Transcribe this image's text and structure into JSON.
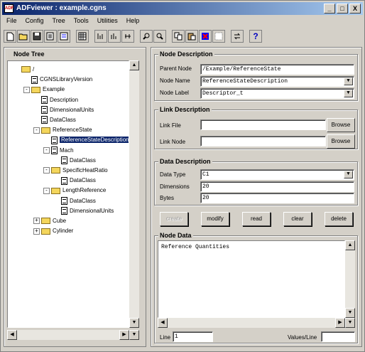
{
  "window": {
    "title": "ADFviewer : example.cgns",
    "app_icon_text": "ADF",
    "minimize": "_",
    "maximize": "□",
    "close": "X"
  },
  "menu": [
    "File",
    "Config",
    "Tree",
    "Tools",
    "Utilities",
    "Help"
  ],
  "toolbar": {
    "help_label": "?"
  },
  "node_tree": {
    "title": "Node Tree",
    "nodes": [
      {
        "label": "/",
        "type": "folder",
        "expander": ""
      },
      {
        "label": "CGNSLibraryVersion",
        "type": "doc",
        "expander": ""
      },
      {
        "label": "Example",
        "type": "folder",
        "expander": "-"
      },
      {
        "label": "Description",
        "type": "doc",
        "expander": ""
      },
      {
        "label": "DimensionalUnits",
        "type": "doc",
        "expander": ""
      },
      {
        "label": "DataClass",
        "type": "doc",
        "expander": ""
      },
      {
        "label": "ReferenceState",
        "type": "folder",
        "expander": "-"
      },
      {
        "label": "ReferenceStateDescription",
        "type": "doc",
        "expander": "",
        "selected": true
      },
      {
        "label": "Mach",
        "type": "doc",
        "expander": "-"
      },
      {
        "label": "DataClass",
        "type": "doc",
        "expander": ""
      },
      {
        "label": "SpecificHeatRatio",
        "type": "folder",
        "expander": "-"
      },
      {
        "label": "DataClass",
        "type": "doc",
        "expander": ""
      },
      {
        "label": "LengthReference",
        "type": "folder",
        "expander": "-"
      },
      {
        "label": "DataClass",
        "type": "doc",
        "expander": ""
      },
      {
        "label": "DimensionalUnits",
        "type": "doc",
        "expander": ""
      },
      {
        "label": "Cube",
        "type": "folder",
        "expander": "+"
      },
      {
        "label": "Cylinder",
        "type": "folder",
        "expander": "+"
      }
    ]
  },
  "node_description": {
    "title": "Node Description",
    "parent_node_label": "Parent Node",
    "parent_node_value": "/Example/ReferenceState",
    "node_name_label": "Node Name",
    "node_name_value": "ReferenceStateDescription",
    "node_label_label": "Node Label",
    "node_label_value": "Descriptor_t"
  },
  "link_description": {
    "title": "Link Description",
    "link_file_label": "Link File",
    "link_file_value": "",
    "link_node_label": "Link Node",
    "link_node_value": "",
    "browse_label": "Browse"
  },
  "data_description": {
    "title": "Data Description",
    "data_type_label": "Data Type",
    "data_type_value": "C1",
    "dimensions_label": "Dimensions",
    "dimensions_value": "20",
    "bytes_label": "Bytes",
    "bytes_value": "20"
  },
  "actions": {
    "create": "create",
    "modify": "modify",
    "read": "read",
    "clear": "clear",
    "delete": "delete"
  },
  "node_data": {
    "title": "Node Data",
    "content": "Reference Quantities",
    "line_label": "Line",
    "line_value": "1",
    "values_per_line_label": "Values/Line",
    "values_per_line_value": ""
  }
}
